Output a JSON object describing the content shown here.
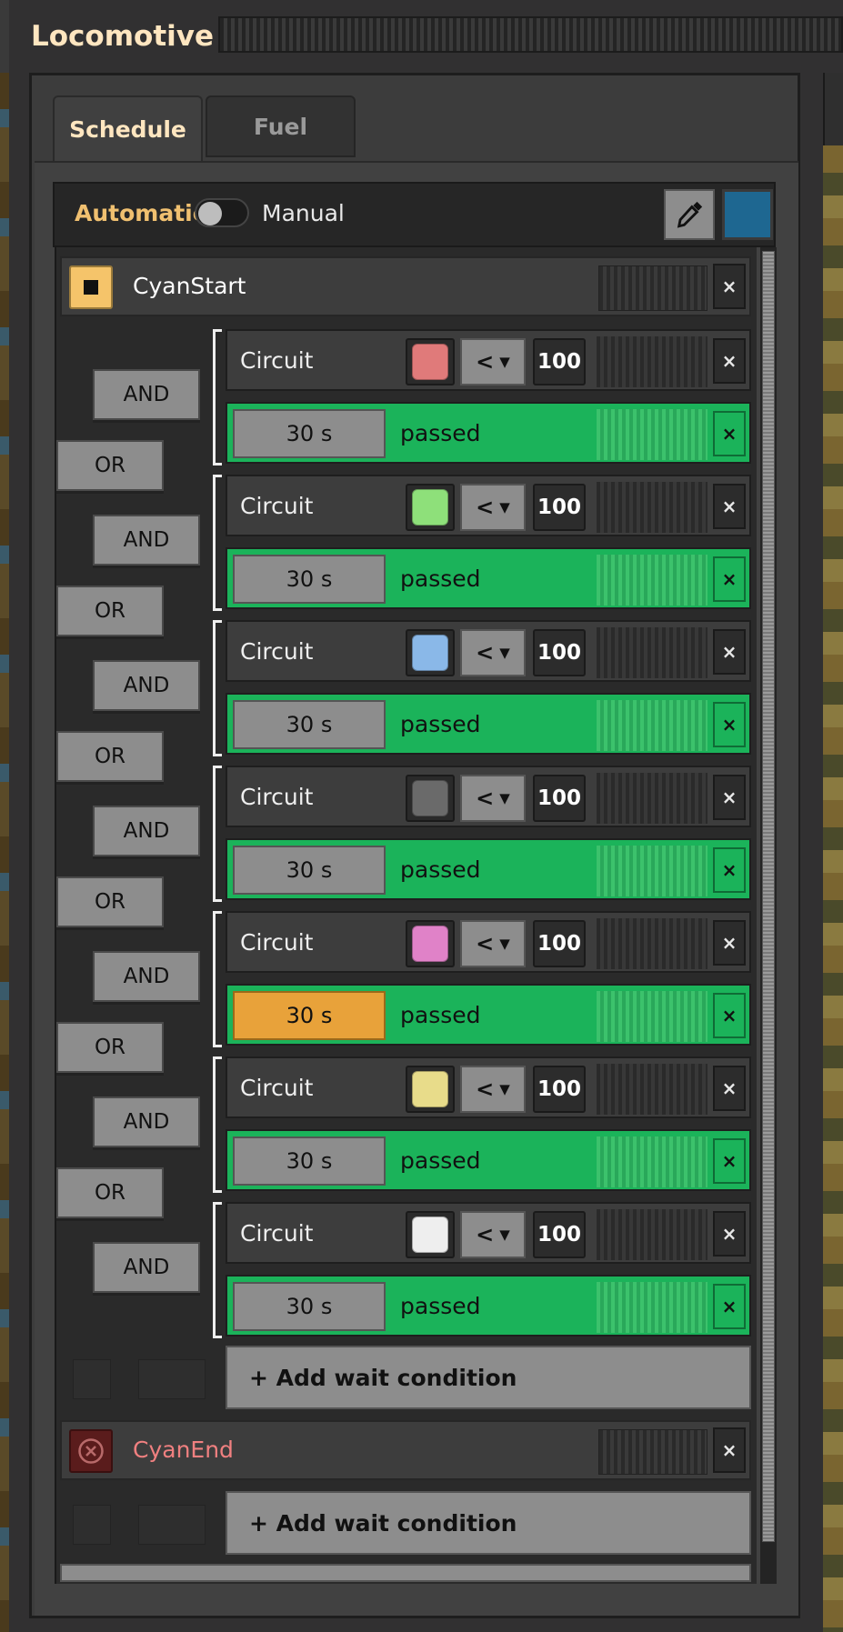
{
  "window": {
    "title": "Locomotive"
  },
  "tabs": [
    {
      "label": "Schedule",
      "active": true
    },
    {
      "label": "Fuel",
      "active": false
    }
  ],
  "mode": {
    "automatic_label": "Automatic",
    "manual_label": "Manual",
    "train_color": "#1e6791"
  },
  "stations": [
    {
      "name": "CyanStart",
      "name_color": "#ffffff",
      "icon": "stop-square-icon",
      "close": "×"
    },
    {
      "name": "CyanEnd",
      "name_color": "#f08080",
      "icon": "error-circle-icon",
      "close": "×"
    }
  ],
  "condition_groups": [
    {
      "circuit_label": "Circuit",
      "signal_color": "#e07a7a",
      "comparator": "<",
      "value": "100",
      "time": "30 s",
      "time_suffix": "passed",
      "and_label": "AND",
      "or_label": "OR"
    },
    {
      "circuit_label": "Circuit",
      "signal_color": "#8ee07a",
      "comparator": "<",
      "value": "100",
      "time": "30 s",
      "time_suffix": "passed",
      "and_label": "AND",
      "or_label": "OR"
    },
    {
      "circuit_label": "Circuit",
      "signal_color": "#8ab8e8",
      "comparator": "<",
      "value": "100",
      "time": "30 s",
      "time_suffix": "passed",
      "and_label": "AND",
      "or_label": "OR"
    },
    {
      "circuit_label": "Circuit",
      "signal_color": "#6a6a6a",
      "comparator": "<",
      "value": "100",
      "time": "30 s",
      "time_suffix": "passed",
      "and_label": "AND",
      "or_label": "OR"
    },
    {
      "circuit_label": "Circuit",
      "signal_color": "#e082c8",
      "comparator": "<",
      "value": "100",
      "time": "30 s",
      "time_suffix": "passed",
      "and_label": "AND",
      "or_label": "OR",
      "time_highlight": true
    },
    {
      "circuit_label": "Circuit",
      "signal_color": "#e8dc8a",
      "comparator": "<",
      "value": "100",
      "time": "30 s",
      "time_suffix": "passed",
      "and_label": "AND",
      "or_label": "OR"
    },
    {
      "circuit_label": "Circuit",
      "signal_color": "#eeeeee",
      "comparator": "<",
      "value": "100",
      "time": "30 s",
      "time_suffix": "passed",
      "and_label": "AND"
    }
  ],
  "add_wait_label": "+ Add wait condition",
  "close_symbol": "×"
}
